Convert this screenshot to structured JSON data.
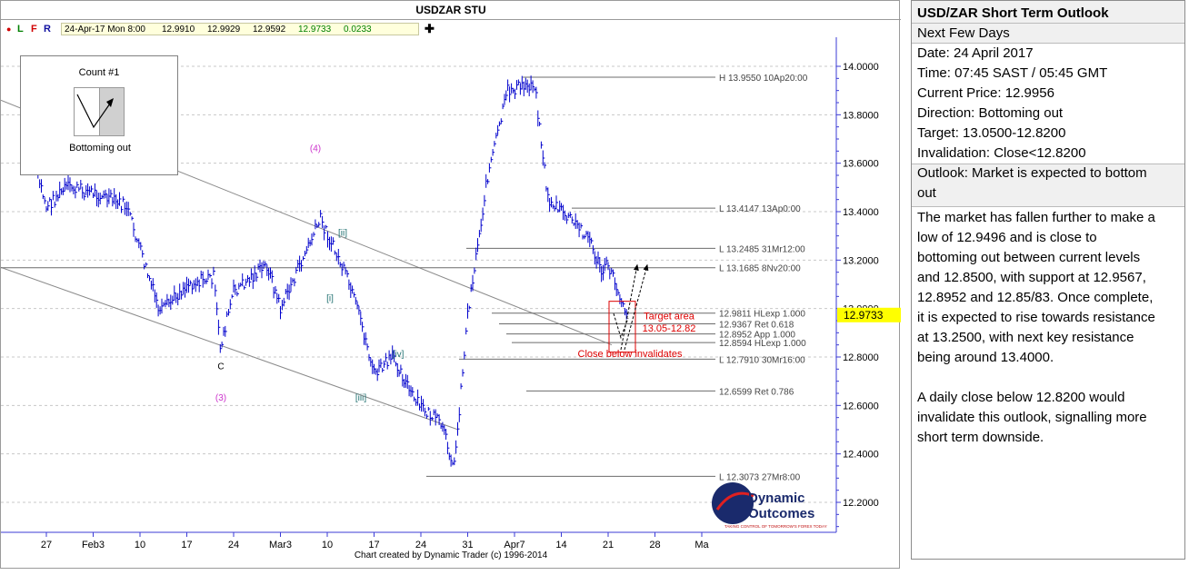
{
  "chart_title": "USDZAR STU",
  "toolbar": {
    "letters": [
      "L",
      "F",
      "R"
    ],
    "datetime": "24-Apr-17 Mon 8:00",
    "open": "12.9910",
    "high": "12.9929",
    "low": "12.9592",
    "close": "12.9733",
    "change": "0.0233"
  },
  "count_box": {
    "title": "Count #1",
    "description": "Bottoming out"
  },
  "footer": "Chart created by Dynamic Trader  (c) 1996-2014",
  "logo": {
    "line1": "Dynamic",
    "line2": "Outcomes",
    "tagline": "TAKING CONTROL OF TOMORROW'S FOREX TODAY"
  },
  "right_panel": {
    "title": "USD/ZAR Short Term Outlook",
    "subtitle": "Next Few Days",
    "date": "Date: 24 April 2017",
    "time": "Time: 07:45 SAST / 05:45 GMT",
    "current_price": "Current Price: 12.9956",
    "direction": "Direction:  Bottoming out",
    "target": "Target:  13.0500-12.8200",
    "invalidation": "Invalidation:  Close<12.8200",
    "outlook_line1": "Outlook:  Market is expected to bottom",
    "outlook_line2": "out",
    "body_lines": [
      "The market has fallen further to make a",
      "low of 12.9496 and is close to",
      "bottoming out between current levels",
      "and 12.8500, with support at 12.9567,",
      "12.8952 and 12.85/83.  Once complete,",
      "it is expected to rise towards resistance",
      "at 13.2500, with next key resistance",
      "being around 13.4000."
    ],
    "body_lines2": [
      "A daily close below 12.8200 would",
      "invalidate this outlook, signalling more",
      "short term downside."
    ]
  },
  "chart_data": {
    "type": "line",
    "title": "USDZAR STU",
    "ylim": [
      12.08,
      14.08
    ],
    "y_ticks": [
      "14.0000",
      "13.8000",
      "13.6000",
      "13.4000",
      "13.2000",
      "13.0000",
      "12.8000",
      "12.6000",
      "12.4000",
      "12.2000"
    ],
    "x_ticks": [
      "27",
      "Feb3",
      "10",
      "17",
      "24",
      "Mar3",
      "10",
      "17",
      "24",
      "31",
      "Apr7",
      "14",
      "21",
      "28",
      "Ma"
    ],
    "current_price_label": "12.9733",
    "current_price": 12.9733,
    "series": [
      {
        "x": [
          "Jan25",
          "Jan27",
          "Jan30",
          "Feb3",
          "Feb8",
          "Feb13",
          "Feb17",
          "Feb21",
          "Feb22",
          "Feb24",
          "Mar1",
          "Mar3",
          "Mar9",
          "Mar13",
          "Mar15",
          "Mar17",
          "Mar20",
          "Mar23",
          "Mar27",
          "Mar29",
          "Mar31",
          "Apr3",
          "Apr6",
          "Apr10",
          "Apr12",
          "Apr14",
          "Apr18",
          "Apr20",
          "Apr21",
          "Apr24"
        ],
        "values": [
          13.62,
          13.42,
          13.5,
          13.48,
          13.42,
          12.98,
          13.1,
          13.13,
          12.84,
          13.07,
          13.18,
          13.0,
          13.37,
          13.12,
          12.95,
          12.73,
          12.8,
          12.62,
          12.52,
          12.35,
          12.98,
          13.55,
          13.9,
          13.93,
          13.45,
          13.4,
          13.3,
          13.15,
          13.18,
          12.97
        ]
      }
    ],
    "levels": [
      {
        "label": "H 13.9550 10Ap20:00",
        "value": 13.955
      },
      {
        "label": "L 13.4147 13Ap0:00",
        "value": 13.4147
      },
      {
        "label": "L 13.2485 31Mr12:00",
        "value": 13.2485
      },
      {
        "label": "L 13.1685 8Nv20:00",
        "value": 13.1685
      },
      {
        "label": "12.9811 HLexp 1.000",
        "value": 12.9811
      },
      {
        "label": "12.9367 Ret 0.618",
        "value": 12.9367
      },
      {
        "label": "12.8952 App 1.000",
        "value": 12.8952
      },
      {
        "label": "12.8594 HLexp 1.000",
        "value": 12.8594
      },
      {
        "label": "L 12.7910 30Mr16:00",
        "value": 12.791
      },
      {
        "label": "12.6599 Ret 0.786",
        "value": 12.6599
      },
      {
        "label": "L 12.3073 27Mr8:00",
        "value": 12.3073
      }
    ],
    "wave_labels": [
      {
        "text": "(4)",
        "color": "#cc33cc"
      },
      {
        "text": "[ii]",
        "color": "#207070"
      },
      {
        "text": "[i]",
        "color": "#207070"
      },
      {
        "text": "[iv]",
        "color": "#207070"
      },
      {
        "text": "[iii]",
        "color": "#207070"
      },
      {
        "text": "C",
        "color": "#000000"
      },
      {
        "text": "(3)",
        "color": "#cc33cc"
      }
    ],
    "annotations": {
      "target_title": "Target area",
      "target_range": "13.05-12.82",
      "invalidation": "Close below invalidates"
    },
    "colors": {
      "price": "#0000cc",
      "axis": "#3b3bd6",
      "current_price_bg": "#ffff00",
      "annotation": "#dd0000"
    }
  }
}
